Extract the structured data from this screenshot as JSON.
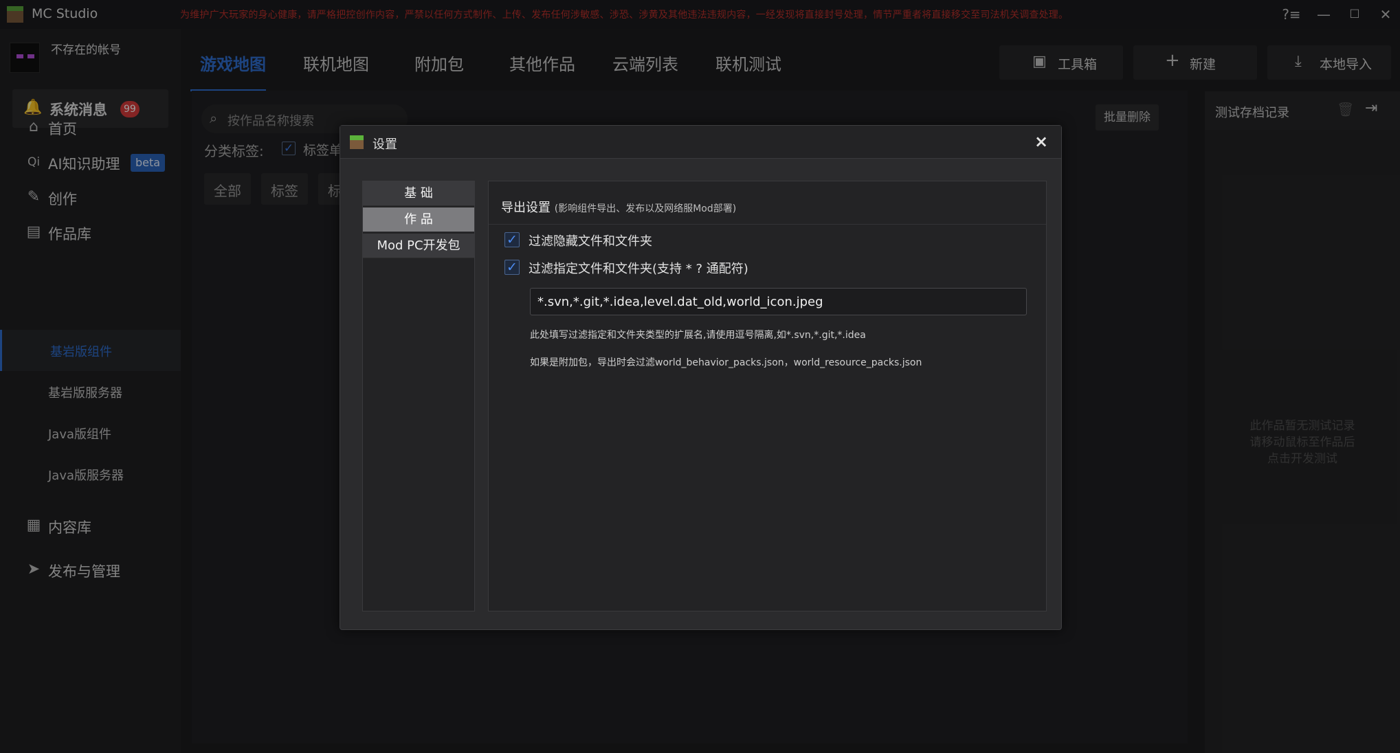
{
  "app": {
    "title": "MC Studio",
    "notice": "为维护广大玩家的身心健康，请严格把控创作内容，严禁以任何方式制作、上传、发布任何涉敏感、涉恐、涉黄及其他违法违规内容，一经发现将直接封号处理，情节严重者将直接移交至司法机关调查处理。",
    "window_controls": [
      "?≡",
      "—",
      "☐",
      "✕"
    ]
  },
  "sidebar": {
    "account_name": "不存在的帐号",
    "system_messages": {
      "label": "系统消息",
      "badge": "99"
    },
    "nav": [
      {
        "label": "首页",
        "icon": "home-icon"
      },
      {
        "label": "AI知识助理",
        "icon": "ai-icon",
        "badge": "beta"
      },
      {
        "label": "创作",
        "icon": "pen-icon"
      },
      {
        "label": "作品库",
        "icon": "library-icon"
      }
    ],
    "sub_items": [
      "基岩版组件",
      "基岩版服务器",
      "Java版组件",
      "Java版服务器"
    ],
    "nav_bottom": [
      {
        "label": "内容库",
        "icon": "grid-icon"
      },
      {
        "label": "发布与管理",
        "icon": "send-icon"
      }
    ]
  },
  "main": {
    "tabs": [
      "游戏地图",
      "联机地图",
      "附加包",
      "其他作品",
      "云端列表",
      "联机测试"
    ],
    "active_tab": 0,
    "buttons": {
      "toolbox": "工具箱",
      "new": "新建",
      "import": "本地导入"
    },
    "search_placeholder": "按作品名称搜索",
    "category_label": "分类标签:",
    "category_check_label": "标签单",
    "chips": [
      "全部",
      "标签",
      "标"
    ],
    "batch_delete": "批量删除"
  },
  "right_panel": {
    "title": "测试存档记录",
    "empty_lines": [
      "此作品暂无测试记录",
      "请移动鼠标至作品后",
      "点击开发测试"
    ]
  },
  "modal": {
    "title": "设置",
    "close": "×",
    "nav": [
      "基 础",
      "作 品",
      "Mod PC开发包"
    ],
    "active_nav": 1,
    "section_title": "导出设置",
    "section_note": "(影响组件导出、发布以及网络服Mod部署)",
    "options": [
      {
        "label": "过滤隐藏文件和文件夹",
        "checked": true
      },
      {
        "label": "过滤指定文件和文件夹(支持 * ? 通配符)",
        "checked": true
      }
    ],
    "filter_value": "*.svn,*.git,*.idea,level.dat_old,world_icon.jpeg",
    "hint1": "此处填写过滤指定和文件夹类型的扩展名,请使用逗号隔离,如*.svn,*.git,*.idea",
    "hint2": "如果是附加包，导出时会过滤world_behavior_packs.json，world_resource_packs.json"
  },
  "colors": {
    "accent": "#2f6fd1",
    "notice": "#b8302b",
    "badge": "#d63a3a"
  }
}
